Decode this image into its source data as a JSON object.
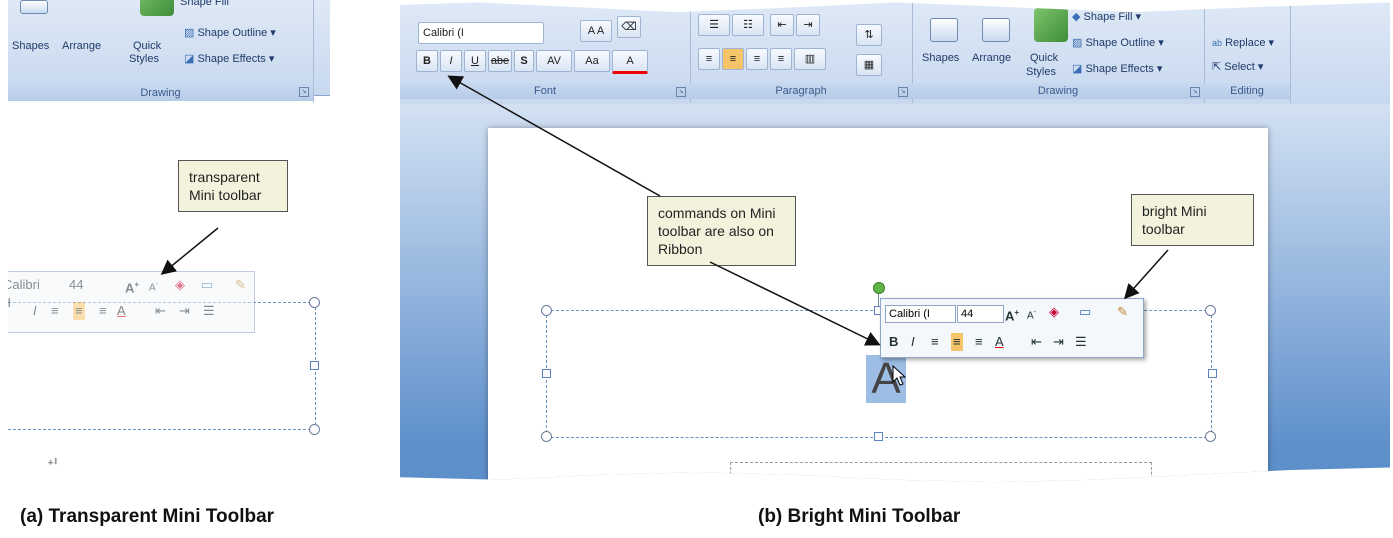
{
  "captions": {
    "left": "(a) Transparent Mini Toolbar",
    "right": "(b) Bright Mini Toolbar"
  },
  "callouts": {
    "transparent": "transparent Mini toolbar",
    "commands": "commands on Mini toolbar are also on Ribbon",
    "bright": "bright Mini toolbar"
  },
  "ribbon": {
    "font_group": "Font",
    "paragraph_group": "Paragraph",
    "drawing_group": "Drawing",
    "editing_group": "Editing",
    "font_name": "Calibri (I",
    "shapes": "Shapes",
    "arrange": "Arrange",
    "quick": "Quick",
    "styles": "Styles",
    "shape_fill": "Shape Fill",
    "shape_outline": "Shape Outline",
    "shape_effects": "Shape Effects",
    "replace": "Replace",
    "select": "Select",
    "bold": "B",
    "italic": "I",
    "underline": "U",
    "strike": "abe",
    "shadow": "S",
    "spacing": "AV",
    "change_case": "Aa",
    "font_color": "A"
  },
  "mini": {
    "font_left": "Calibri (I",
    "font_right": "Calibri (I",
    "size": "44",
    "bold": "B",
    "italic": "I"
  },
  "slide_text": "A",
  "colors": {
    "ribbon": "#c7d8ef",
    "callout": "#f3f3dd",
    "accent_orange": "#f6c468"
  }
}
